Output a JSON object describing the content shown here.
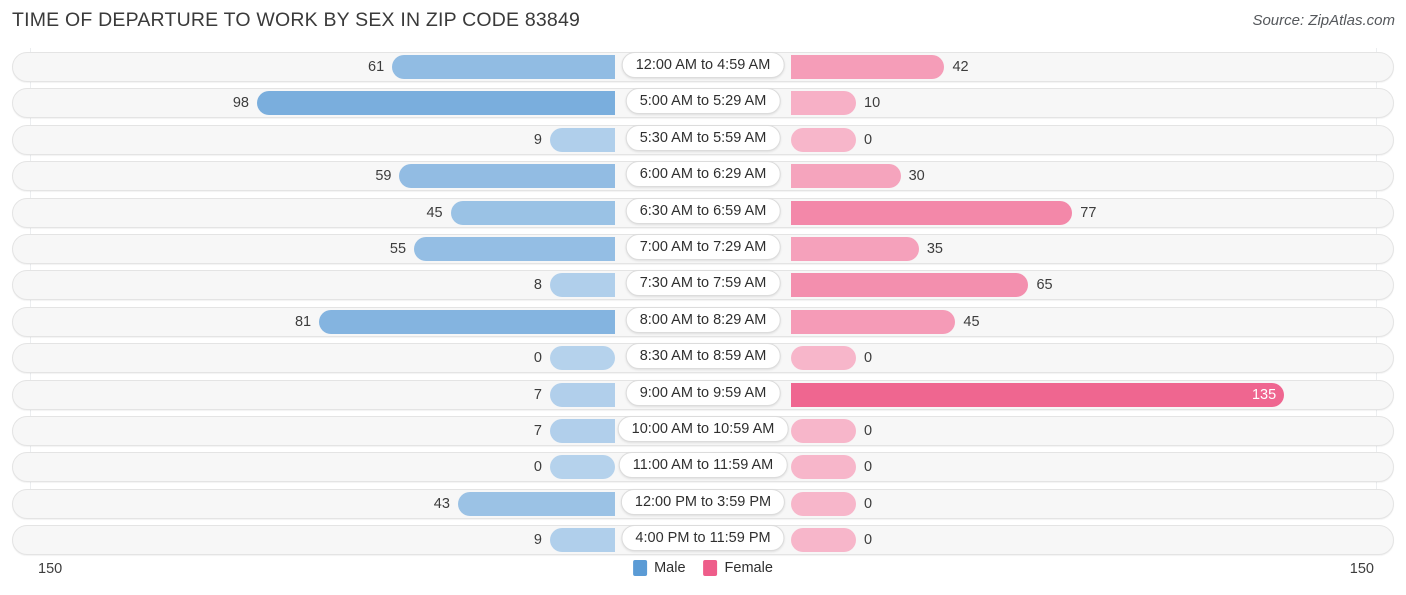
{
  "header": {
    "title": "TIME OF DEPARTURE TO WORK BY SEX IN ZIP CODE 83849",
    "source": "Source: ZipAtlas.com"
  },
  "legend": {
    "male_label": "Male",
    "female_label": "Female",
    "male_color": "#5b9bd5",
    "female_color": "#ee5d8a"
  },
  "axis": {
    "left_max_label": "150",
    "right_max_label": "150",
    "max": 150
  },
  "chart_data": {
    "type": "bar",
    "title": "TIME OF DEPARTURE TO WORK BY SEX IN ZIP CODE 83849",
    "subtitle": "Source: ZipAtlas.com",
    "orientation": "horizontal-diverging",
    "xlabel": "",
    "ylabel": "",
    "xlim": [
      150,
      150
    ],
    "grid": true,
    "legend_position": "bottom-center",
    "categories": [
      "12:00 AM to 4:59 AM",
      "5:00 AM to 5:29 AM",
      "5:30 AM to 5:59 AM",
      "6:00 AM to 6:29 AM",
      "6:30 AM to 6:59 AM",
      "7:00 AM to 7:29 AM",
      "7:30 AM to 7:59 AM",
      "8:00 AM to 8:29 AM",
      "8:30 AM to 8:59 AM",
      "9:00 AM to 9:59 AM",
      "10:00 AM to 10:59 AM",
      "11:00 AM to 11:59 AM",
      "12:00 PM to 3:59 PM",
      "4:00 PM to 11:59 PM"
    ],
    "series": [
      {
        "name": "Male",
        "color": "#5b9bd5",
        "side": "left",
        "values": [
          61,
          98,
          9,
          59,
          45,
          55,
          8,
          81,
          0,
          7,
          7,
          0,
          43,
          9
        ]
      },
      {
        "name": "Female",
        "color": "#ee5d8a",
        "side": "right",
        "values": [
          42,
          10,
          0,
          30,
          77,
          35,
          65,
          45,
          0,
          135,
          0,
          0,
          0,
          0
        ]
      }
    ]
  }
}
